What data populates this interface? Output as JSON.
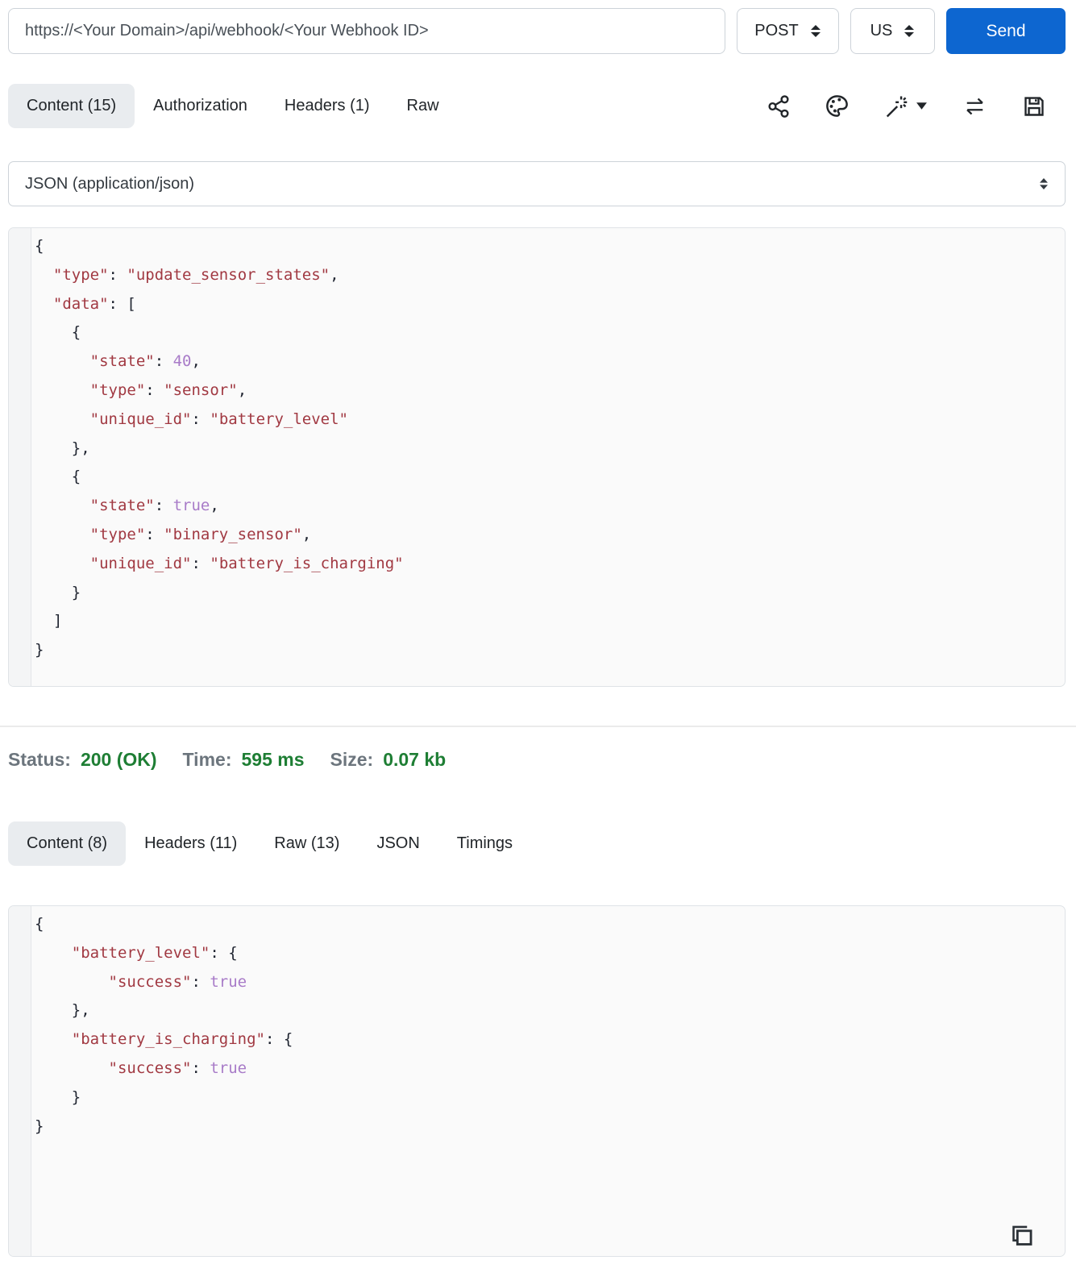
{
  "request_bar": {
    "url": "https://<Your Domain>/api/webhook/<Your Webhook ID>",
    "method": "POST",
    "region": "US",
    "send_label": "Send"
  },
  "request_tabs": [
    {
      "label": "Content (15)",
      "active": true
    },
    {
      "label": "Authorization",
      "active": false
    },
    {
      "label": "Headers (1)",
      "active": false
    },
    {
      "label": "Raw",
      "active": false
    }
  ],
  "toolbar_icons": [
    "share-icon",
    "palette-icon",
    "magic-wand-icon",
    "swap-arrows-icon",
    "save-icon"
  ],
  "content_type": {
    "selected": "JSON (application/json)"
  },
  "request_body": "{\n  \"type\": \"update_sensor_states\",\n  \"data\": [\n    {\n      \"state\": 40,\n      \"type\": \"sensor\",\n      \"unique_id\": \"battery_level\"\n    },\n    {\n      \"state\": true,\n      \"type\": \"binary_sensor\",\n      \"unique_id\": \"battery_is_charging\"\n    }\n  ]\n}",
  "status_bar": {
    "status_label": "Status:",
    "status_value": "200 (OK)",
    "time_label": "Time:",
    "time_value": "595 ms",
    "size_label": "Size:",
    "size_value": "0.07 kb"
  },
  "response_tabs": [
    {
      "label": "Content (8)",
      "active": true
    },
    {
      "label": "Headers (11)",
      "active": false
    },
    {
      "label": "Raw (13)",
      "active": false
    },
    {
      "label": "JSON",
      "active": false
    },
    {
      "label": "Timings",
      "active": false
    }
  ],
  "response_body": "{\n    \"battery_level\": {\n        \"success\": true\n    },\n    \"battery_is_charging\": {\n        \"success\": true\n    }\n}",
  "colors": {
    "send_button": "#0d66d0",
    "status_green": "#1e7e34",
    "label_gray": "#6c757d",
    "string_token": "#a13942",
    "literal_token": "#a87bc8",
    "active_tab_bg": "#e9ecef"
  }
}
